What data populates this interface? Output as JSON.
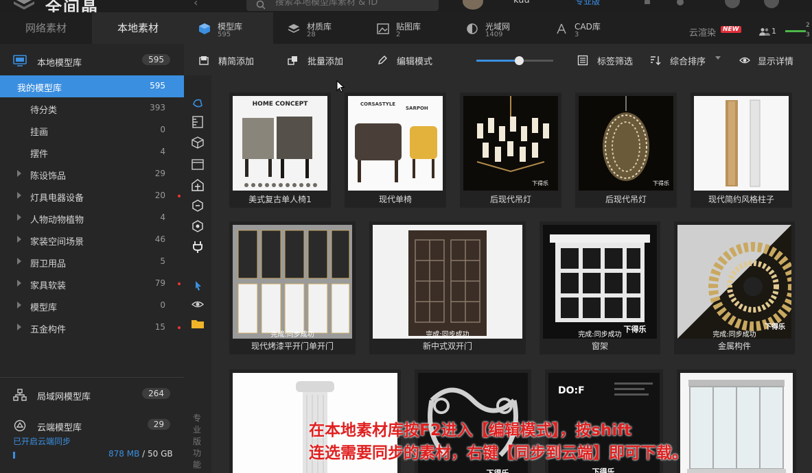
{
  "header": {
    "app_title": "全间晶",
    "search_placeholder": "搜索本地模型库素材 & ID",
    "username": "kuu",
    "pro_label": "专业版"
  },
  "left_tabs": {
    "network": "网络素材",
    "local": "本地素材"
  },
  "local_library": {
    "label": "本地模型库",
    "count": "595"
  },
  "tree": [
    {
      "label": "我的模型库",
      "count": "595",
      "level": 0
    },
    {
      "label": "待分类",
      "count": "393",
      "level": 1
    },
    {
      "label": "挂画",
      "count": "0",
      "level": 1
    },
    {
      "label": "摆件",
      "count": "4",
      "level": 1
    },
    {
      "label": "陈设饰品",
      "count": "29",
      "level": 1,
      "arrow": true
    },
    {
      "label": "灯具电器设备",
      "count": "20",
      "level": 1,
      "arrow": true,
      "dot": true
    },
    {
      "label": "人物动物植物",
      "count": "4",
      "level": 1,
      "arrow": true
    },
    {
      "label": "家装空间场景",
      "count": "46",
      "level": 1,
      "arrow": true
    },
    {
      "label": "厨卫用品",
      "count": "5",
      "level": 1,
      "arrow": true
    },
    {
      "label": "家具软装",
      "count": "79",
      "level": 1,
      "arrow": true,
      "dot": true
    },
    {
      "label": "模型库",
      "count": "0",
      "level": 1,
      "arrow": true
    },
    {
      "label": "五金构件",
      "count": "15",
      "level": 1,
      "arrow": true,
      "dot": true
    }
  ],
  "lan_library": {
    "label": "局域网模型库",
    "count": "264"
  },
  "cloud_library": {
    "label": "云端模型库",
    "count": "29",
    "sync_text": "已开启云端同步",
    "used": "878 MB",
    "total": "/ 50 GB"
  },
  "category_tabs": [
    {
      "name": "模型库",
      "count": "595"
    },
    {
      "name": "材质库",
      "count": "28"
    },
    {
      "name": "贴图库",
      "count": "2"
    },
    {
      "name": "光域网",
      "count": "1409"
    },
    {
      "name": "CAD库",
      "count": "3"
    }
  ],
  "cloud_render": {
    "label": "云渲染",
    "badge": "NEW"
  },
  "online_users": "1",
  "mini_nums": [
    "2",
    "3"
  ],
  "toolbar": {
    "precise_add": "精简添加",
    "batch_add": "批量添加",
    "edit_mode": "编辑模式",
    "tag_filter": "标签筛选",
    "sort": "综合排序",
    "show_details": "显示详情",
    "zoom_level": 0.55
  },
  "vertical_label": "专业版功能",
  "cards": [
    {
      "title": "美式复古单人椅1",
      "sync": ""
    },
    {
      "title": "现代单椅",
      "sync": ""
    },
    {
      "title": "后现代吊灯",
      "sync": ""
    },
    {
      "title": "后现代吊灯",
      "sync": ""
    },
    {
      "title": "现代简约风格柱子",
      "sync": ""
    },
    {
      "title": "现代烤漆平开门单开门",
      "sync": "完成:同步成功"
    },
    {
      "title": "新中式双开门",
      "sync": "完成:同步成功"
    },
    {
      "title": "窗架",
      "sync": "完成:同步成功"
    },
    {
      "title": "金属构件",
      "sync": "完成:同步成功"
    },
    {
      "title": "",
      "sync": ""
    },
    {
      "title": "",
      "sync": ""
    },
    {
      "title": "",
      "sync": ""
    },
    {
      "title": "",
      "sync": ""
    }
  ],
  "thumb_texts": {
    "home_concept": "HOME CONCEPT",
    "corsastyle": "CORSASTYLE",
    "sarpoh": "SARPOH",
    "watermark": "下得乐",
    "dof": "DO:F"
  },
  "overlay_caption": {
    "line1": "在本地素材库按F2进入【编辑模式】，按shift",
    "line2": "连选需要同步的素材，右键【同步到云端】即可下载。"
  },
  "colors": {
    "accent": "#3b8fe0",
    "selection": "#3b8fe0",
    "caption": "#e02020",
    "new_badge": "#e0303a",
    "online": "#4db848"
  }
}
